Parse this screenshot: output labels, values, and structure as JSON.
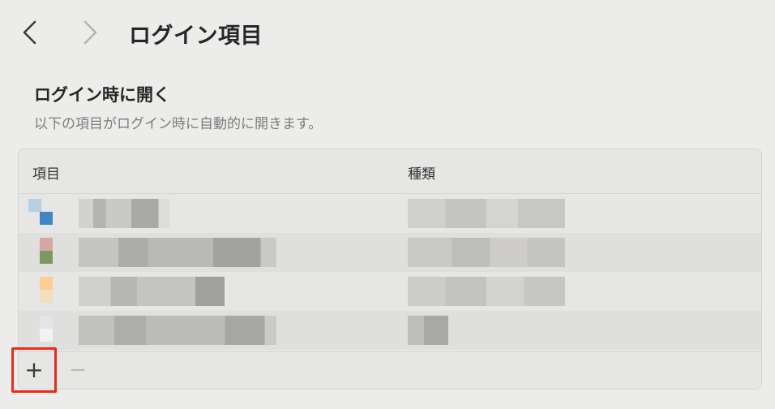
{
  "header": {
    "title": "ログイン項目",
    "back_icon": "chevron-left-icon",
    "forward_icon": "chevron-right-icon"
  },
  "section": {
    "title": "ログイン時に開く",
    "subtitle": "以下の項目がログイン時に自動的に開きます。"
  },
  "table": {
    "columns": [
      "項目",
      "種類"
    ],
    "rows": [
      {
        "icon_colors": [
          "#3d87c8",
          "#b7cfe2"
        ],
        "name": "",
        "kind": ""
      },
      {
        "icon_colors": [
          "#7a9a62",
          "#d7a6a3"
        ],
        "name": "",
        "kind": ""
      },
      {
        "icon_colors": [
          "#fbcf90",
          "#f2dfc0"
        ],
        "name": "",
        "kind": ""
      },
      {
        "icon_colors": [
          "#f2f2f2",
          "#e2e4e8"
        ],
        "name": "",
        "kind": ""
      }
    ]
  },
  "footer": {
    "add_label": "+",
    "remove_label": "−"
  },
  "colors": {
    "highlight": "#ee2a17",
    "background": "#ececea"
  }
}
